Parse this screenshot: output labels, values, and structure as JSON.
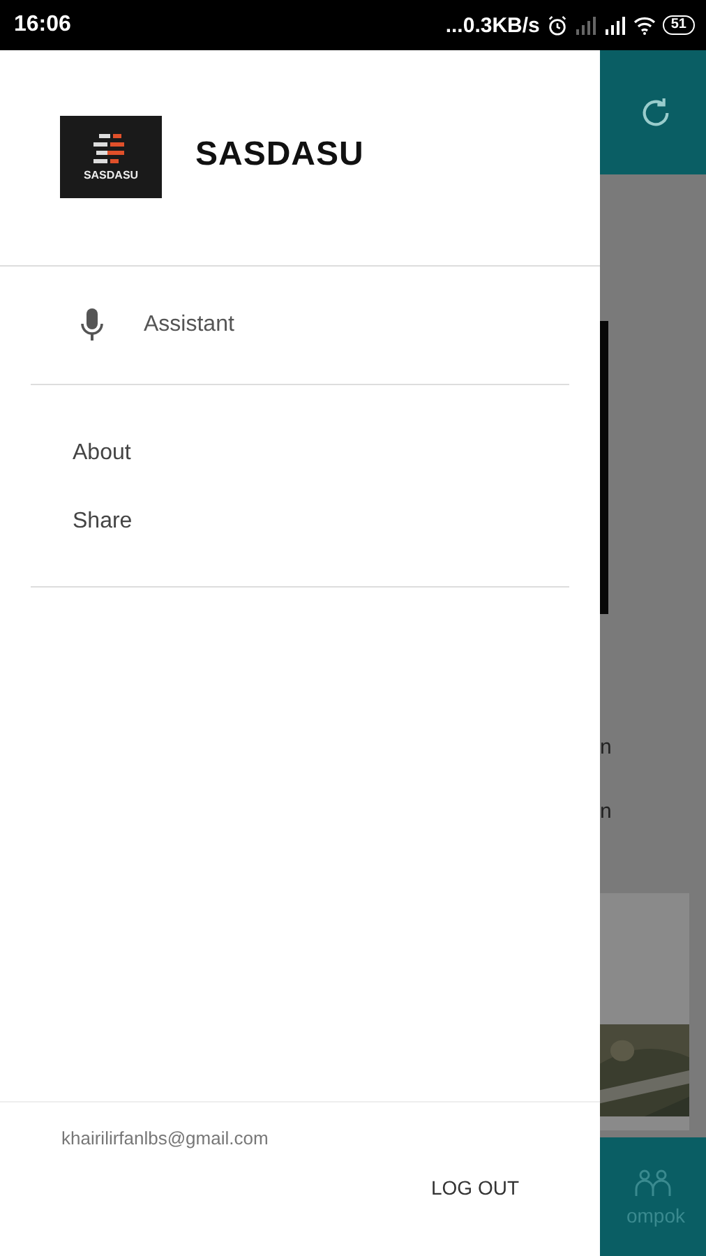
{
  "status_bar": {
    "time": "16:06",
    "network_speed": "...0.3KB/s",
    "battery": "51"
  },
  "background_app": {
    "text_fragments": [
      "n",
      "n"
    ],
    "nav_label": "ompok"
  },
  "drawer": {
    "logo_text": "SASDASU",
    "title": "SASDASU",
    "primary_items": [
      {
        "label": "Assistant",
        "kind": "mic"
      }
    ],
    "secondary_items": [
      {
        "label": "About"
      },
      {
        "label": "Share"
      }
    ],
    "email": "khairilirfanlbs@gmail.com",
    "logout": "LOG OUT"
  }
}
